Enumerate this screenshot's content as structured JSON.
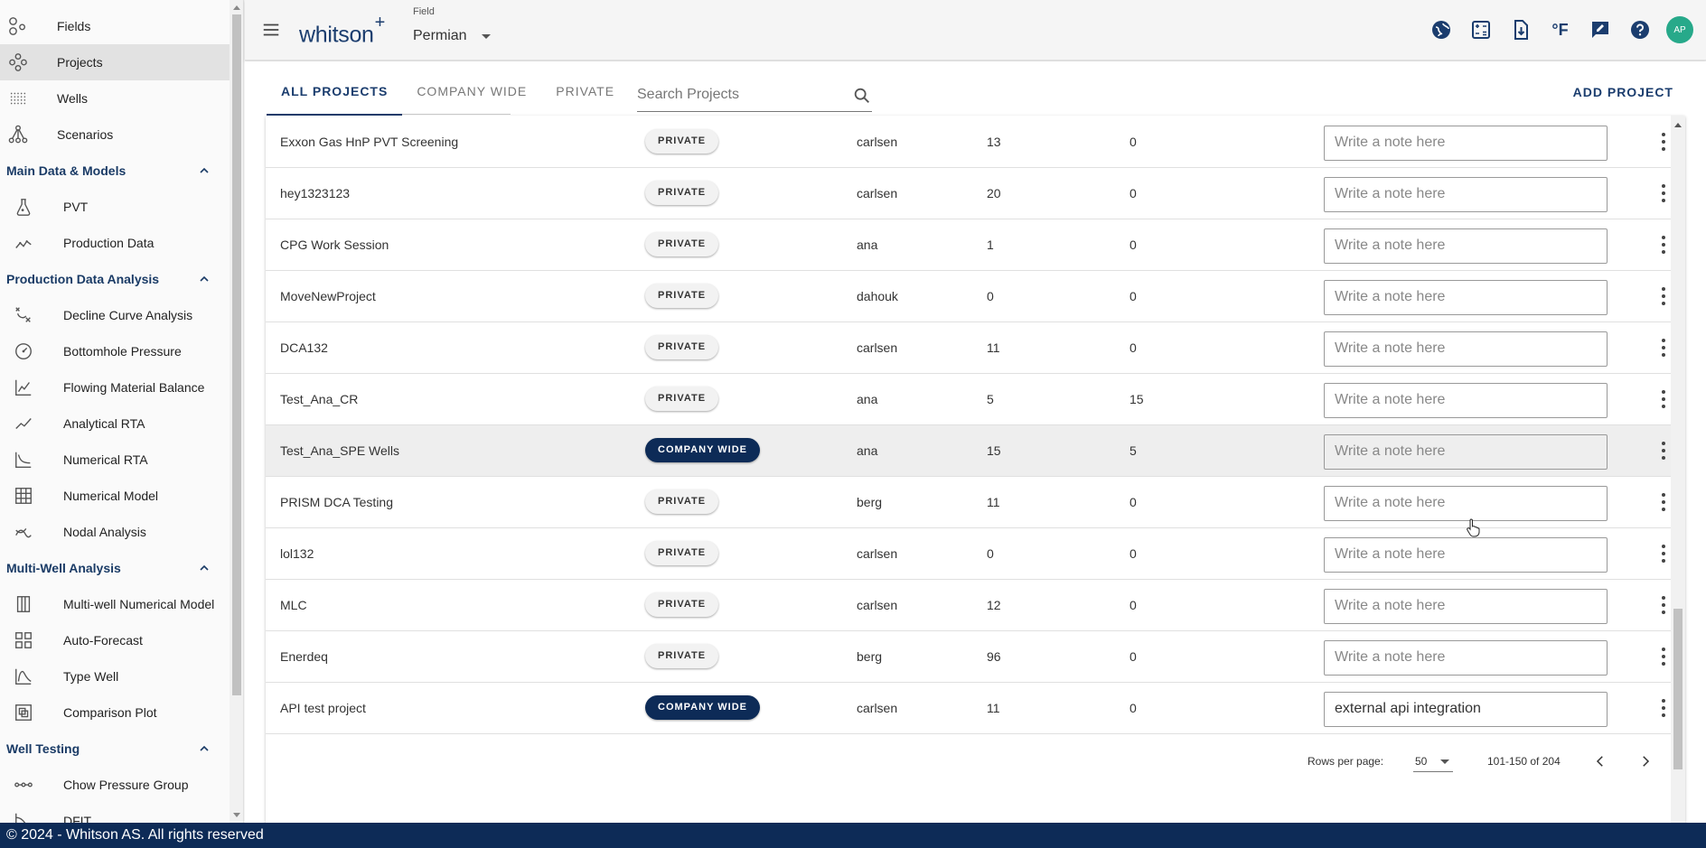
{
  "sidebar": {
    "top_items": [
      {
        "label": "Fields",
        "icon": "fields-icon"
      },
      {
        "label": "Projects",
        "icon": "projects-icon",
        "active": true
      },
      {
        "label": "Wells",
        "icon": "wells-icon"
      },
      {
        "label": "Scenarios",
        "icon": "scenarios-icon"
      }
    ],
    "sections": [
      {
        "title": "Main Data & Models",
        "items": [
          "PVT",
          "Production Data"
        ]
      },
      {
        "title": "Production Data Analysis",
        "items": [
          "Decline Curve Analysis",
          "Bottomhole Pressure",
          "Flowing Material Balance",
          "Analytical RTA",
          "Numerical RTA",
          "Numerical Model",
          "Nodal Analysis"
        ]
      },
      {
        "title": "Multi-Well Analysis",
        "items": [
          "Multi-well Numerical Model",
          "Auto-Forecast",
          "Type Well",
          "Comparison Plot"
        ]
      },
      {
        "title": "Well Testing",
        "items": [
          "Chow Pressure Group",
          "DFIT"
        ]
      }
    ]
  },
  "header": {
    "logo": "whitson",
    "logo_plus": "+",
    "field_label": "Field",
    "field_value": "Permian",
    "avatar": "AP",
    "unit_label": "°F"
  },
  "tabs": [
    {
      "label": "ALL PROJECTS",
      "active": true
    },
    {
      "label": "COMPANY WIDE",
      "active": false
    },
    {
      "label": "PRIVATE",
      "active": false
    }
  ],
  "search": {
    "placeholder": "Search Projects"
  },
  "add_project": "ADD PROJECT",
  "note_placeholder": "Write a note here",
  "rows": [
    {
      "name": "Exxon Gas HnP PVT Screening",
      "visibility": "PRIVATE",
      "owner": "carlsen",
      "wells": "13",
      "scenarios": "0",
      "note": ""
    },
    {
      "name": "hey1323123",
      "visibility": "PRIVATE",
      "owner": "carlsen",
      "wells": "20",
      "scenarios": "0",
      "note": ""
    },
    {
      "name": "CPG Work Session",
      "visibility": "PRIVATE",
      "owner": "ana",
      "wells": "1",
      "scenarios": "0",
      "note": ""
    },
    {
      "name": "MoveNewProject",
      "visibility": "PRIVATE",
      "owner": "dahouk",
      "wells": "0",
      "scenarios": "0",
      "note": ""
    },
    {
      "name": "DCA132",
      "visibility": "PRIVATE",
      "owner": "carlsen",
      "wells": "11",
      "scenarios": "0",
      "note": ""
    },
    {
      "name": "Test_Ana_CR",
      "visibility": "PRIVATE",
      "owner": "ana",
      "wells": "5",
      "scenarios": "15",
      "note": ""
    },
    {
      "name": "Test_Ana_SPE Wells",
      "visibility": "COMPANY WIDE",
      "owner": "ana",
      "wells": "15",
      "scenarios": "5",
      "note": "",
      "hover": true
    },
    {
      "name": "PRISM DCA Testing",
      "visibility": "PRIVATE",
      "owner": "berg",
      "wells": "11",
      "scenarios": "0",
      "note": ""
    },
    {
      "name": "lol132",
      "visibility": "PRIVATE",
      "owner": "carlsen",
      "wells": "0",
      "scenarios": "0",
      "note": ""
    },
    {
      "name": "MLC",
      "visibility": "PRIVATE",
      "owner": "carlsen",
      "wells": "12",
      "scenarios": "0",
      "note": ""
    },
    {
      "name": "Enerdeq",
      "visibility": "PRIVATE",
      "owner": "berg",
      "wells": "96",
      "scenarios": "0",
      "note": ""
    },
    {
      "name": "API test project",
      "visibility": "COMPANY WIDE",
      "owner": "carlsen",
      "wells": "11",
      "scenarios": "0",
      "note": "external api integration"
    }
  ],
  "pagination": {
    "rows_per_page_label": "Rows per page:",
    "rows_per_page": "50",
    "range": "101-150 of 204"
  },
  "footer": "© 2024 - Whitson AS. All rights reserved",
  "colors": {
    "brand": "#1b3d6e",
    "footer": "#0d2b57",
    "avatar": "#27a98a"
  }
}
